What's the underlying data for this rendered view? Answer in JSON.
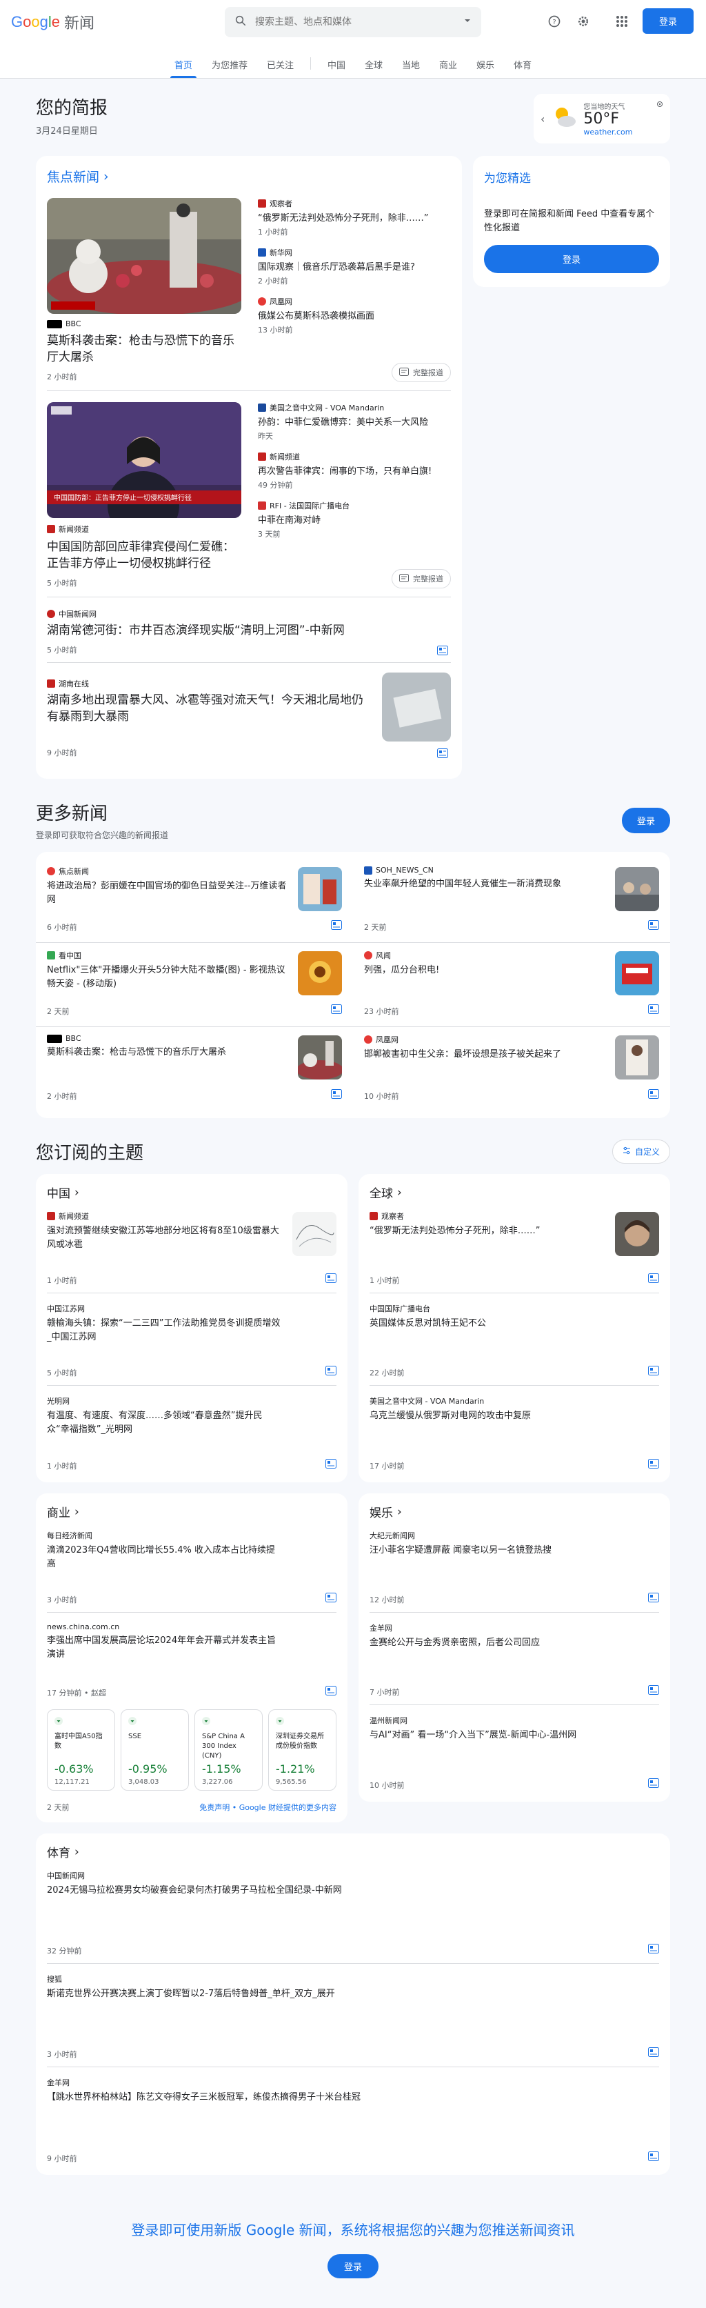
{
  "header": {
    "logo_google": [
      "G",
      "o",
      "o",
      "g",
      "l",
      "e"
    ],
    "logo_news": "新闻",
    "search_placeholder": "搜索主题、地点和媒体",
    "signin_label": "登录"
  },
  "nav": {
    "tabs_primary": [
      "首页",
      "为您推荐",
      "已关注"
    ],
    "tabs_secondary": [
      "中国",
      "全球",
      "当地",
      "商业",
      "娱乐",
      "体育"
    ]
  },
  "briefing": {
    "title": "您的简报",
    "date": "3月24日星期日"
  },
  "weather": {
    "label": "您当地的天气",
    "temp": "50°F",
    "source": "weather.com"
  },
  "top_stories": {
    "title": "焦点新闻",
    "full_coverage_label": "完整报道",
    "clusters": [
      {
        "main": {
          "source": "BBC",
          "title": "莫斯科袭击案：枪击与恐慌下的音乐厅大屠杀",
          "time": "2 小时前"
        },
        "side": [
          {
            "source": "观察者",
            "title": "“俄罗斯无法判处恐怖分子死刑，除非……”",
            "time": "1 小时前"
          },
          {
            "source": "新华网",
            "title": "国际观察｜俄音乐厅恐袭幕后黑手是谁?",
            "time": "2 小时前"
          },
          {
            "source": "凤凰网",
            "title": "俄媒公布莫斯科恐袭模拟画面",
            "time": "13 小时前"
          }
        ]
      },
      {
        "main": {
          "source": "新闻频道",
          "title": "中国国防部回应菲律宾侵闯仁爱礁：正告菲方停止一切侵权挑衅行径",
          "time": "5 小时前",
          "image_caption": "中国国防部：正告菲方停止一切侵权挑衅行径"
        },
        "side": [
          {
            "source": "美国之音中文网 - VOA Mandarin",
            "title": "孙韵：中菲仁爱礁博弈：美中关系一大风险",
            "time": "昨天"
          },
          {
            "source": "新闻频道",
            "title": "再次警告菲律宾：闹事的下场，只有单白旗!",
            "time": "49 分钟前"
          },
          {
            "source": "RFI - 法国国际广播电台",
            "title": "中菲在南海对峙",
            "time": "3 天前"
          }
        ]
      }
    ],
    "rows": [
      {
        "source": "中国新闻网",
        "title": "湖南常德河街：市井百态演绎现实版“清明上河图”-中新网",
        "time": "5 小时前"
      },
      {
        "source": "湖南在线",
        "title": "湖南多地出现雷暴大风、冰雹等强对流天气！今天湘北局地仍有暴雨到大暴雨",
        "time": "9 小时前"
      }
    ]
  },
  "picks": {
    "title": "为您精选",
    "text": "登录即可在简报和新闻 Feed 中查看专属个性化报道",
    "button": "登录"
  },
  "more_news": {
    "title": "更多新闻",
    "subtitle": "登录即可获取符合您兴趣的新闻报道",
    "button": "登录",
    "items": [
      {
        "source": "焦点新闻",
        "title": "将进政治局？彭丽媛在中国官场的御色日益受关注--万维读者网",
        "time": "6 小时前"
      },
      {
        "source": "SOH_NEWS_CN",
        "title": "失业率飙升绝望的中国年轻人竟催生一新消费现象",
        "time": "2 天前"
      },
      {
        "source": "看中国",
        "title": "Netflix\"三体\"开播爆火开头5分钟大陆不敢播(图) - 影视热议畅天姿 - (移动版)",
        "time": "2 天前"
      },
      {
        "source": "风闻",
        "title": "列强，瓜分台积电!",
        "time": "23 小时前"
      },
      {
        "source": "BBC",
        "title": "莫斯科袭击案：枪击与恐慌下的音乐厅大屠杀",
        "time": "2 小时前"
      },
      {
        "source": "凤凰网",
        "title": "邯郸被害初中生父亲：最坏设想是孩子被关起来了",
        "time": "10 小时前"
      }
    ]
  },
  "topics": {
    "title": "您订阅的主题",
    "customize_label": "自定义",
    "china": {
      "title": "中国",
      "items": [
        {
          "source": "新闻频道",
          "title": "强对流预警继续安徽江苏等地部分地区将有8至10级雷暴大风或冰雹",
          "time": "1 小时前"
        },
        {
          "source": "中国江苏网",
          "title": "赣榆海头镇：探索“一二三四”工作法助推党员冬训提质增效_中国江苏网",
          "time": "5 小时前"
        },
        {
          "source": "光明网",
          "title": "有温度、有速度、有深度……多领域“春意盎然”提升民众“幸福指数”_光明网",
          "time": "1 小时前"
        }
      ]
    },
    "world": {
      "title": "全球",
      "items": [
        {
          "source": "观察者",
          "title": "“俄罗斯无法判处恐怖分子死刑，除非……”",
          "time": "1 小时前"
        },
        {
          "source": "中国国际广播电台",
          "title": "英国媒体反思对凯特王妃不公",
          "time": "22 小时前"
        },
        {
          "source": "美国之音中文网 - VOA Mandarin",
          "title": "乌克兰缓慢从俄罗斯对电网的攻击中复原",
          "time": "17 小时前"
        }
      ]
    },
    "business": {
      "title": "商业",
      "items": [
        {
          "source": "每日经济新闻",
          "title": "滴滴2023年Q4营收同比增长55.4% 收入成本占比持续提高",
          "time": "3 小时前"
        },
        {
          "source": "news.china.com.cn",
          "title": "李强出席中国发展高层论坛2024年年会开幕式并发表主旨演讲",
          "time": "17 分钟前 • 赵超"
        }
      ],
      "stocks": [
        {
          "name": "富时中国A50指数",
          "change": "-0.63%",
          "value": "12,117.21"
        },
        {
          "name": "SSE",
          "change": "-0.95%",
          "value": "3,048.03"
        },
        {
          "name": "S&P China A 300 Index (CNY)",
          "change": "-1.15%",
          "value": "3,227.06"
        },
        {
          "name": "深圳证券交易所成份股价指数",
          "change": "-1.21%",
          "value": "9,565.56"
        }
      ],
      "stocks_time": "2 天前",
      "disclaimer": "免责声明 • Google 财经提供的更多内容"
    },
    "entertainment": {
      "title": "娱乐",
      "items": [
        {
          "source": "大纪元新闻网",
          "title": "汪小菲名字疑遭屏蔽 闻豪宅以另一名镜登热搜",
          "time": "12 小时前"
        },
        {
          "source": "金羊网",
          "title": "金赛纶公开与金秀贤亲密照，后者公司回应",
          "time": "7 小时前"
        },
        {
          "source": "温州新闻网",
          "title": "与AI“对画” 看一场“介入当下”展览-新闻中心-温州网",
          "time": "10 小时前"
        }
      ]
    },
    "sports": {
      "title": "体育",
      "items": [
        {
          "source": "中国新闻网",
          "title": "2024无锡马拉松赛男女均破赛会纪录何杰打破男子马拉松全国纪录-中新网",
          "time": "32 分钟前"
        },
        {
          "source": "搜狐",
          "title": "斯诺克世界公开赛决赛上演丁俊晖暂以2-7落后特鲁姆普_单杆_双方_展开",
          "time": "3 小时前"
        },
        {
          "source": "金羊网",
          "title": "【跳水世界杯柏林站】陈艺文夺得女子三米板冠军，练俊杰摘得男子十米台桂冠",
          "time": "9 小时前"
        }
      ]
    }
  },
  "footer": {
    "text": "登录即可使用新版 Google 新闻，系统将根据您的兴趣为您推送新闻资讯",
    "button": "登录"
  }
}
